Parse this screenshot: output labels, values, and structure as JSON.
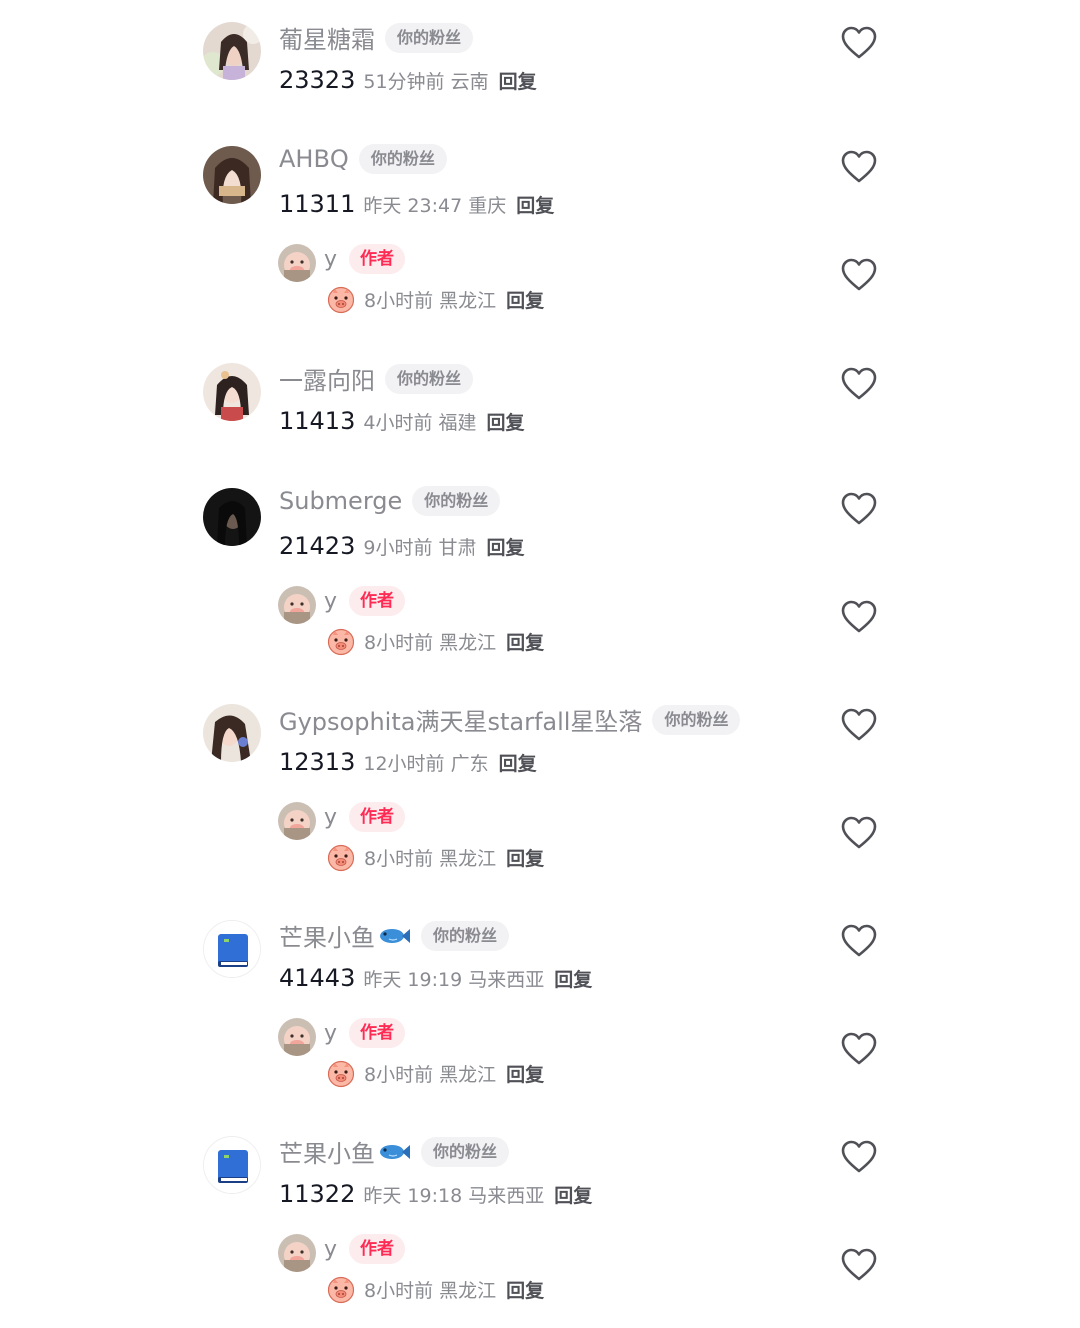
{
  "badges": {
    "fan": "你的粉丝",
    "author": "作者"
  },
  "reply_label": "回复",
  "icons": {
    "like": "heart-outline-icon",
    "fish": "fish-emoji-icon",
    "book": "blue-book-icon",
    "sticker": "pig-sticker-emoji"
  },
  "colors": {
    "name": "#8a8b91",
    "author_badge": "#fe2c55",
    "author_badge_bg": "#fdecee",
    "fan_badge_bg": "#f2f2f4"
  },
  "comments": [
    {
      "name": "葡星糖霜",
      "text": "23323",
      "time": "51分钟前 云南",
      "reply": null
    },
    {
      "name": "AHBQ",
      "text": "11311",
      "time": "昨天 23:47 重庆",
      "reply": {
        "name": "y",
        "time": "8小时前 黑龙江"
      }
    },
    {
      "name": "一露向阳",
      "text": "11413",
      "time": "4小时前 福建",
      "reply": null
    },
    {
      "name": "Submerge",
      "text": "21423",
      "time": "9小时前 甘肃",
      "reply": {
        "name": "y",
        "time": "8小时前 黑龙江"
      }
    },
    {
      "name": "Gypsophita满天星starfall星坠落",
      "text": "12313",
      "time": "12小时前 广东",
      "reply": {
        "name": "y",
        "time": "8小时前 黑龙江"
      }
    },
    {
      "name": "芒果小鱼",
      "text": "41443",
      "time": "昨天 19:19 马来西亚",
      "reply": {
        "name": "y",
        "time": "8小时前 黑龙江"
      }
    },
    {
      "name": "芒果小鱼",
      "text": "11322",
      "time": "昨天 19:18 马来西亚",
      "reply": {
        "name": "y",
        "time": "8小时前 黑龙江"
      }
    }
  ]
}
